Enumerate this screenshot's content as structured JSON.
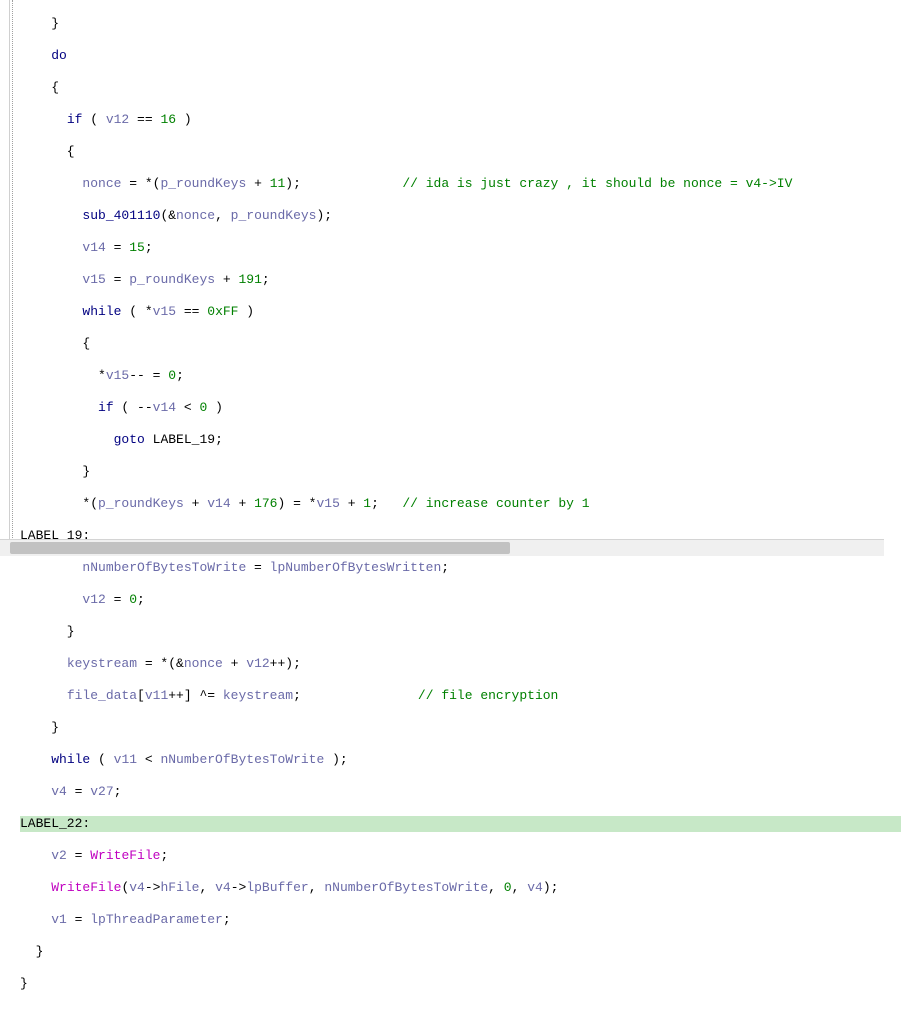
{
  "l1": "    }",
  "l2a": "    ",
  "l2b": "do",
  "l3": "    {",
  "l4a": "      ",
  "l4b": "if",
  "l4c": " ( ",
  "l4d": "v12",
  "l4e": " == ",
  "l4f": "16",
  "l4g": " )",
  "l5": "      {",
  "l6a": "        ",
  "l6b": "nonce",
  "l6c": " = *(",
  "l6d": "p_roundKeys",
  "l6e": " + ",
  "l6f": "11",
  "l6g": ");",
  "l6h": "             ",
  "l6i": "// ida is just crazy , it should be nonce = v4->IV",
  "l7a": "        ",
  "l7b": "sub_401110",
  "l7c": "(&",
  "l7d": "nonce",
  "l7e": ", ",
  "l7f": "p_roundKeys",
  "l7g": ");",
  "l8a": "        ",
  "l8b": "v14",
  "l8c": " = ",
  "l8d": "15",
  "l8e": ";",
  "l9a": "        ",
  "l9b": "v15",
  "l9c": " = ",
  "l9d": "p_roundKeys",
  "l9e": " + ",
  "l9f": "191",
  "l9g": ";",
  "l10a": "        ",
  "l10b": "while",
  "l10c": " ( *",
  "l10d": "v15",
  "l10e": " == ",
  "l10f": "0xFF",
  "l10g": " )",
  "l11": "        {",
  "l12a": "          *",
  "l12b": "v15",
  "l12c": "-- = ",
  "l12d": "0",
  "l12e": ";",
  "l13a": "          ",
  "l13b": "if",
  "l13c": " ( --",
  "l13d": "v14",
  "l13e": " < ",
  "l13f": "0",
  "l13g": " )",
  "l14a": "            ",
  "l14b": "goto",
  "l14c": " ",
  "l14d": "LABEL_19",
  "l14e": ";",
  "l15": "        }",
  "l16a": "        *(",
  "l16b": "p_roundKeys",
  "l16c": " + ",
  "l16d": "v14",
  "l16e": " + ",
  "l16f": "176",
  "l16g": ") = *",
  "l16h": "v15",
  "l16i": " + ",
  "l16j": "1",
  "l16k": ";   ",
  "l16l": "// increase counter by 1",
  "l17": "LABEL_19:",
  "l18a": "        ",
  "l18b": "nNumberOfBytesToWrite",
  "l18c": " = ",
  "l18d": "lpNumberOfBytesWritten",
  "l18e": ";",
  "l19a": "        ",
  "l19b": "v12",
  "l19c": " = ",
  "l19d": "0",
  "l19e": ";",
  "l20": "      }",
  "l21a": "      ",
  "l21b": "keystream",
  "l21c": " = *(&",
  "l21d": "nonce",
  "l21e": " + ",
  "l21f": "v12",
  "l21g": "++);",
  "l22a": "      ",
  "l22b": "file_data",
  "l22c": "[",
  "l22d": "v11",
  "l22e": "++] ^= ",
  "l22f": "keystream",
  "l22g": ";",
  "l22h": "               ",
  "l22i": "// file encryption",
  "l23": "    }",
  "l24a": "    ",
  "l24b": "while",
  "l24c": " ( ",
  "l24d": "v11",
  "l24e": " < ",
  "l24f": "nNumberOfBytesToWrite",
  "l24g": " );",
  "l25a": "    ",
  "l25b": "v4",
  "l25c": " = ",
  "l25d": "v27",
  "l25e": ";",
  "l26": "LABEL_22:",
  "l27a": "    ",
  "l27b": "v2",
  "l27c": " = ",
  "l27d": "WriteFile",
  "l27e": ";",
  "l28a": "    ",
  "l28b": "WriteFile",
  "l28c": "(",
  "l28d": "v4",
  "l28e": "->",
  "l28f": "hFile",
  "l28g": ", ",
  "l28h": "v4",
  "l28i": "->",
  "l28j": "lpBuffer",
  "l28k": ", ",
  "l28l": "nNumberOfBytesToWrite",
  "l28m": ", ",
  "l28n": "0",
  "l28o": ", ",
  "l28p": "v4",
  "l28q": ");",
  "l29a": "    ",
  "l29b": "v1",
  "l29c": " = ",
  "l29d": "lpThreadParameter",
  "l29e": ";",
  "l30": "  }",
  "l31": "}"
}
